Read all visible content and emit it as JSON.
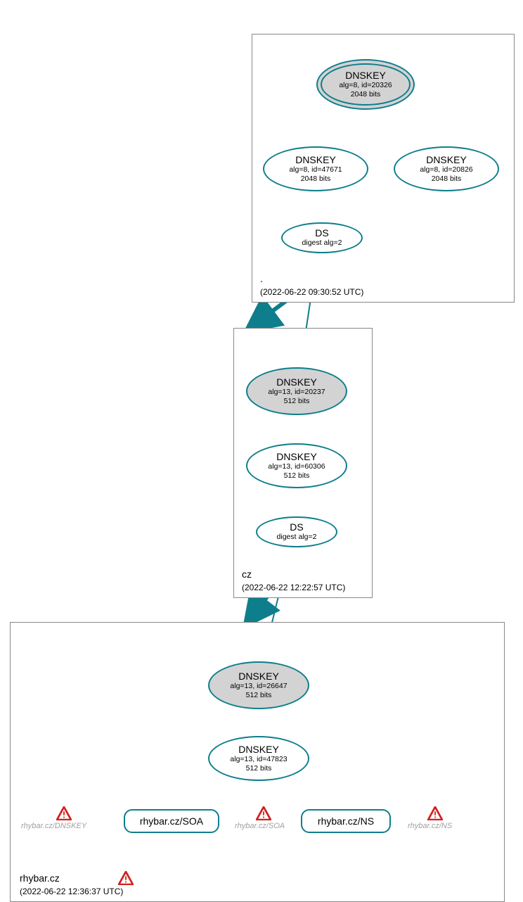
{
  "zones": {
    "root": {
      "name": ".",
      "timestamp": "(2022-06-22 09:30:52 UTC)"
    },
    "cz": {
      "name": "cz",
      "timestamp": "(2022-06-22 12:22:57 UTC)"
    },
    "rhybar": {
      "name": "rhybar.cz",
      "timestamp": "(2022-06-22 12:36:37 UTC)"
    }
  },
  "nodes": {
    "root_ksk": {
      "title": "DNSKEY",
      "line1": "alg=8, id=20326",
      "line2": "2048 bits"
    },
    "root_zsk1": {
      "title": "DNSKEY",
      "line1": "alg=8, id=47671",
      "line2": "2048 bits"
    },
    "root_zsk2": {
      "title": "DNSKEY",
      "line1": "alg=8, id=20826",
      "line2": "2048 bits"
    },
    "root_ds": {
      "title": "DS",
      "line1": "digest alg=2"
    },
    "cz_ksk": {
      "title": "DNSKEY",
      "line1": "alg=13, id=20237",
      "line2": "512 bits"
    },
    "cz_zsk": {
      "title": "DNSKEY",
      "line1": "alg=13, id=60306",
      "line2": "512 bits"
    },
    "cz_ds": {
      "title": "DS",
      "line1": "digest alg=2"
    },
    "rhy_ksk": {
      "title": "DNSKEY",
      "line1": "alg=13, id=26647",
      "line2": "512 bits"
    },
    "rhy_zsk": {
      "title": "DNSKEY",
      "line1": "alg=13, id=47823",
      "line2": "512 bits"
    }
  },
  "rr": {
    "soa": "rhybar.cz/SOA",
    "ns": "rhybar.cz/NS"
  },
  "ghosts": {
    "dnskey": "rhybar.cz/DNSKEY",
    "soa": "rhybar.cz/SOA",
    "ns": "rhybar.cz/NS"
  },
  "chart_data": {
    "type": "graph",
    "description": "DNSSEC authentication chain diagram",
    "zones": [
      {
        "name": ".",
        "timestamp": "2022-06-22 09:30:52 UTC"
      },
      {
        "name": "cz",
        "timestamp": "2022-06-22 12:22:57 UTC"
      },
      {
        "name": "rhybar.cz",
        "timestamp": "2022-06-22 12:36:37 UTC"
      }
    ],
    "nodes": [
      {
        "id": "root_ksk",
        "zone": ".",
        "type": "DNSKEY",
        "alg": 8,
        "key_id": 20326,
        "bits": 2048,
        "ksk": true,
        "trust_anchor": true
      },
      {
        "id": "root_zsk1",
        "zone": ".",
        "type": "DNSKEY",
        "alg": 8,
        "key_id": 47671,
        "bits": 2048
      },
      {
        "id": "root_zsk2",
        "zone": ".",
        "type": "DNSKEY",
        "alg": 8,
        "key_id": 20826,
        "bits": 2048
      },
      {
        "id": "root_ds",
        "zone": ".",
        "type": "DS",
        "digest_alg": 2
      },
      {
        "id": "cz_ksk",
        "zone": "cz",
        "type": "DNSKEY",
        "alg": 13,
        "key_id": 20237,
        "bits": 512,
        "ksk": true
      },
      {
        "id": "cz_zsk",
        "zone": "cz",
        "type": "DNSKEY",
        "alg": 13,
        "key_id": 60306,
        "bits": 512
      },
      {
        "id": "cz_ds",
        "zone": "cz",
        "type": "DS",
        "digest_alg": 2
      },
      {
        "id": "rhy_ksk",
        "zone": "rhybar.cz",
        "type": "DNSKEY",
        "alg": 13,
        "key_id": 26647,
        "bits": 512,
        "ksk": true
      },
      {
        "id": "rhy_zsk",
        "zone": "rhybar.cz",
        "type": "DNSKEY",
        "alg": 13,
        "key_id": 47823,
        "bits": 512
      },
      {
        "id": "rhy_soa",
        "zone": "rhybar.cz",
        "type": "RRset",
        "name": "rhybar.cz/SOA"
      },
      {
        "id": "rhy_ns",
        "zone": "rhybar.cz",
        "type": "RRset",
        "name": "rhybar.cz/NS"
      }
    ],
    "edges": [
      {
        "from": "root_ksk",
        "to": "root_ksk",
        "self": true
      },
      {
        "from": "root_ksk",
        "to": "root_zsk1"
      },
      {
        "from": "root_ksk",
        "to": "root_zsk2"
      },
      {
        "from": "root_zsk1",
        "to": "root_ds"
      },
      {
        "from": "root_ds",
        "to": "cz_ksk"
      },
      {
        "from": "cz_ksk",
        "to": "cz_ksk",
        "self": true
      },
      {
        "from": "cz_ksk",
        "to": "cz_zsk"
      },
      {
        "from": "cz_zsk",
        "to": "cz_ds"
      },
      {
        "from": "cz_ds",
        "to": "rhy_ksk"
      },
      {
        "from": "rhy_ksk",
        "to": "rhy_ksk",
        "self": true
      },
      {
        "from": "rhy_ksk",
        "to": "rhy_zsk"
      },
      {
        "from": "rhy_zsk",
        "to": "rhy_soa"
      },
      {
        "from": "rhy_zsk",
        "to": "rhy_ns"
      }
    ],
    "warnings": [
      {
        "target": "rhybar.cz/DNSKEY"
      },
      {
        "target": "rhybar.cz/SOA"
      },
      {
        "target": "rhybar.cz/NS"
      },
      {
        "target": "rhybar.cz"
      }
    ]
  }
}
